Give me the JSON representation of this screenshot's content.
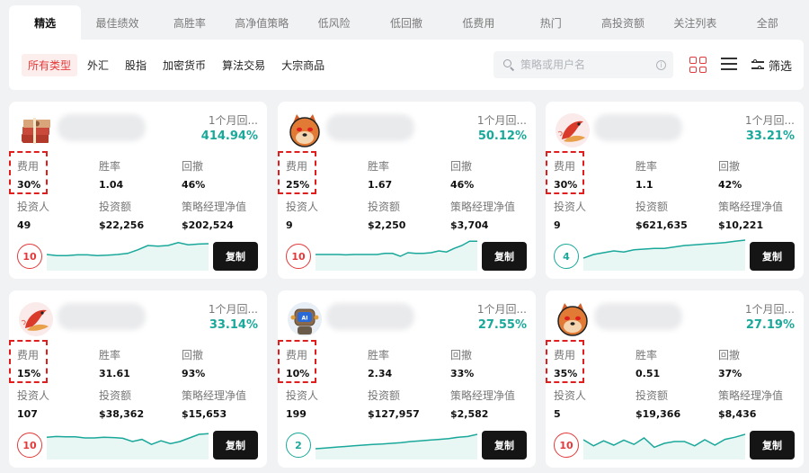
{
  "tabs": [
    "精选",
    "最佳绩效",
    "高胜率",
    "高净值策略",
    "低风险",
    "低回撤",
    "低费用",
    "热门",
    "高投资额",
    "关注列表",
    "全部"
  ],
  "active_tab": 0,
  "filters": {
    "types": [
      "所有类型",
      "外汇",
      "股指",
      "加密货币",
      "算法交易",
      "大宗商品"
    ],
    "active_type": 0,
    "search_placeholder": "策略或用户名",
    "filter_label": "筛选"
  },
  "labels": {
    "period": "1个月回...",
    "fee": "费用",
    "winrate": "胜率",
    "drawdown": "回撤",
    "investors": "投资人",
    "invested": "投资额",
    "nav": "策略经理净值",
    "copy": "复制"
  },
  "colors": {
    "accent_red": "#e23a3a",
    "accent_teal": "#1aa89a",
    "highlight": "#e01e1e"
  },
  "cards": [
    {
      "avatar": "money-stack",
      "return": "414.94%",
      "fee": "30%",
      "winrate": "1.04",
      "drawdown": "46%",
      "investors": "49",
      "invested": "$22,256",
      "nav": "$202,524",
      "score": "10",
      "score_color": "red",
      "spark": [
        0.55,
        0.58,
        0.58,
        0.56,
        0.56,
        0.58,
        0.57,
        0.55,
        0.52,
        0.42,
        0.3,
        0.32,
        0.3,
        0.22,
        0.28,
        0.26,
        0.25
      ]
    },
    {
      "avatar": "shiba-dog",
      "return": "50.12%",
      "fee": "25%",
      "winrate": "1.67",
      "drawdown": "46%",
      "investors": "9",
      "invested": "$2,250",
      "nav": "$3,704",
      "score": "10",
      "score_color": "red",
      "spark": [
        0.55,
        0.55,
        0.55,
        0.55,
        0.56,
        0.55,
        0.55,
        0.55,
        0.55,
        0.52,
        0.52,
        0.6,
        0.5,
        0.52,
        0.52,
        0.5,
        0.45,
        0.48,
        0.38,
        0.3,
        0.18,
        0.18
      ]
    },
    {
      "avatar": "koi-fish",
      "return": "33.21%",
      "fee": "30%",
      "winrate": "1.1",
      "drawdown": "42%",
      "investors": "9",
      "invested": "$621,635",
      "nav": "$10,221",
      "score": "4",
      "score_color": "teal",
      "spark": [
        0.65,
        0.55,
        0.5,
        0.45,
        0.48,
        0.42,
        0.4,
        0.38,
        0.38,
        0.34,
        0.3,
        0.28,
        0.26,
        0.24,
        0.22,
        0.18,
        0.15
      ]
    },
    {
      "avatar": "koi-fish",
      "return": "33.14%",
      "fee": "15%",
      "winrate": "31.61",
      "drawdown": "93%",
      "investors": "107",
      "invested": "$38,362",
      "nav": "$15,653",
      "score": "10",
      "score_color": "red",
      "spark": [
        0.38,
        0.36,
        0.37,
        0.37,
        0.4,
        0.4,
        0.38,
        0.39,
        0.41,
        0.5,
        0.44,
        0.58,
        0.48,
        0.56,
        0.5,
        0.4,
        0.3,
        0.28
      ]
    },
    {
      "avatar": "robot",
      "return": "27.55%",
      "fee": "10%",
      "winrate": "2.34",
      "drawdown": "33%",
      "investors": "199",
      "invested": "$127,957",
      "nav": "$2,582",
      "score": "2",
      "score_color": "teal",
      "spark": [
        0.7,
        0.68,
        0.66,
        0.64,
        0.62,
        0.6,
        0.58,
        0.57,
        0.55,
        0.53,
        0.5,
        0.48,
        0.46,
        0.44,
        0.42,
        0.38,
        0.36,
        0.3
      ]
    },
    {
      "avatar": "shiba-dog",
      "return": "27.19%",
      "fee": "35%",
      "winrate": "0.51",
      "drawdown": "37%",
      "investors": "5",
      "invested": "$19,366",
      "nav": "$8,436",
      "score": "10",
      "score_color": "red",
      "spark": [
        0.45,
        0.62,
        0.48,
        0.6,
        0.46,
        0.58,
        0.4,
        0.66,
        0.55,
        0.5,
        0.5,
        0.62,
        0.45,
        0.6,
        0.44,
        0.38,
        0.3
      ]
    }
  ]
}
